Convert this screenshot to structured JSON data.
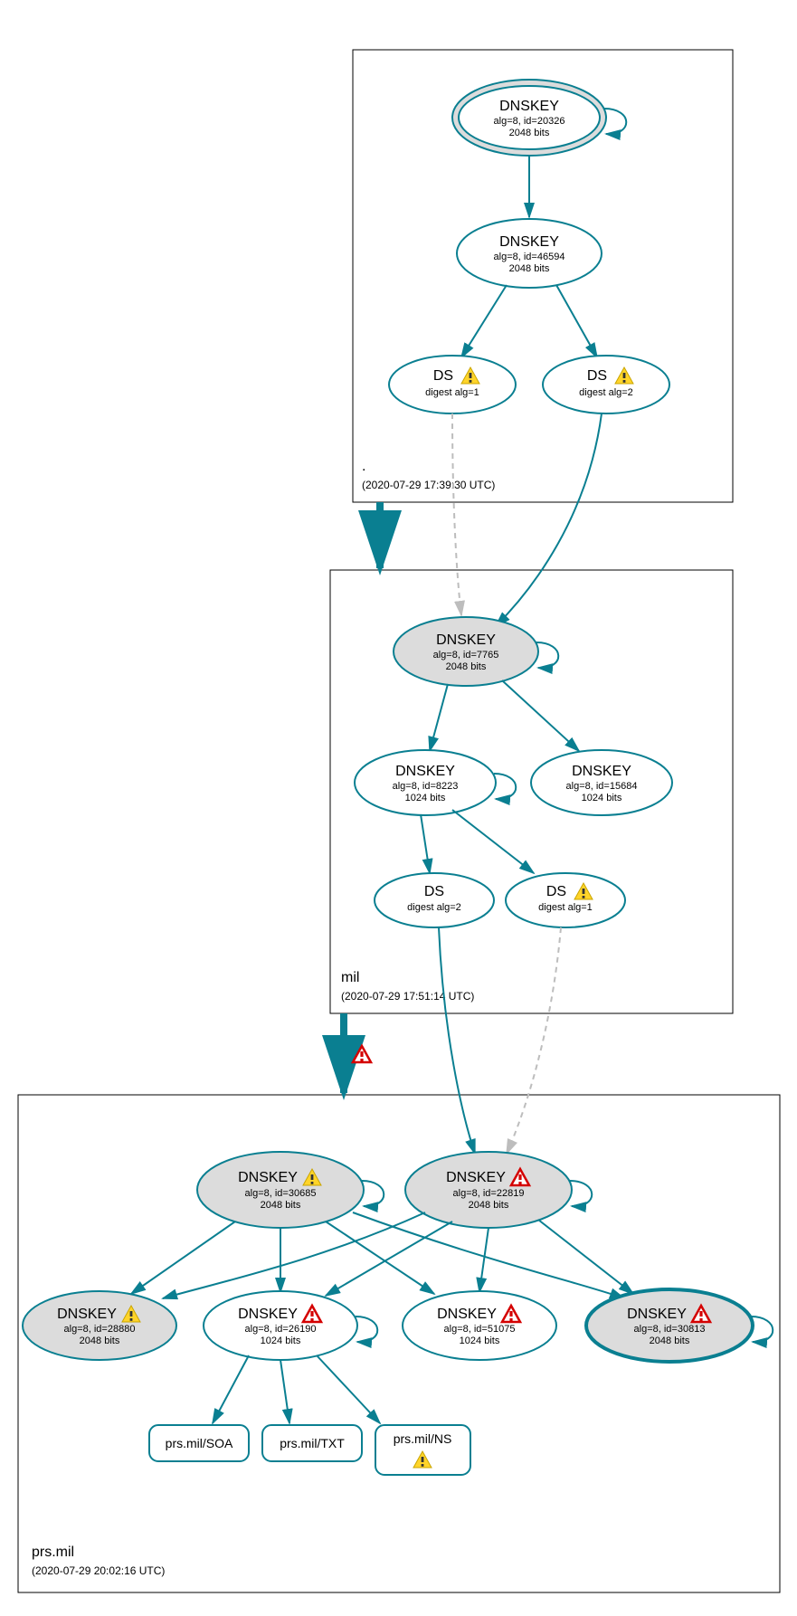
{
  "zones": {
    "root": {
      "label": ".",
      "time": "(2020-07-29 17:39:30 UTC)"
    },
    "mil": {
      "label": "mil",
      "time": "(2020-07-29 17:51:14 UTC)"
    },
    "prs": {
      "label": "prs.mil",
      "time": "(2020-07-29 20:02:16 UTC)"
    }
  },
  "nodes": {
    "root_ksk": {
      "title": "DNSKEY",
      "alg": "alg=8, id=20326",
      "bits": "2048 bits"
    },
    "root_zsk": {
      "title": "DNSKEY",
      "alg": "alg=8, id=46594",
      "bits": "2048 bits"
    },
    "root_ds1": {
      "title": "DS",
      "sub": "digest alg=1"
    },
    "root_ds2": {
      "title": "DS",
      "sub": "digest alg=2"
    },
    "mil_ksk": {
      "title": "DNSKEY",
      "alg": "alg=8, id=7765",
      "bits": "2048 bits"
    },
    "mil_zsk1": {
      "title": "DNSKEY",
      "alg": "alg=8, id=8223",
      "bits": "1024 bits"
    },
    "mil_zsk2": {
      "title": "DNSKEY",
      "alg": "alg=8, id=15684",
      "bits": "1024 bits"
    },
    "mil_ds2": {
      "title": "DS",
      "sub": "digest alg=2"
    },
    "mil_ds1": {
      "title": "DS",
      "sub": "digest alg=1"
    },
    "prs_k1": {
      "title": "DNSKEY",
      "alg": "alg=8, id=30685",
      "bits": "2048 bits"
    },
    "prs_k2": {
      "title": "DNSKEY",
      "alg": "alg=8, id=22819",
      "bits": "2048 bits"
    },
    "prs_k3": {
      "title": "DNSKEY",
      "alg": "alg=8, id=28880",
      "bits": "2048 bits"
    },
    "prs_k4": {
      "title": "DNSKEY",
      "alg": "alg=8, id=26190",
      "bits": "1024 bits"
    },
    "prs_k5": {
      "title": "DNSKEY",
      "alg": "alg=8, id=51075",
      "bits": "1024 bits"
    },
    "prs_k6": {
      "title": "DNSKEY",
      "alg": "alg=8, id=30813",
      "bits": "2048 bits"
    },
    "prs_soa": {
      "label": "prs.mil/SOA"
    },
    "prs_txt": {
      "label": "prs.mil/TXT"
    },
    "prs_ns": {
      "label": "prs.mil/NS"
    }
  }
}
